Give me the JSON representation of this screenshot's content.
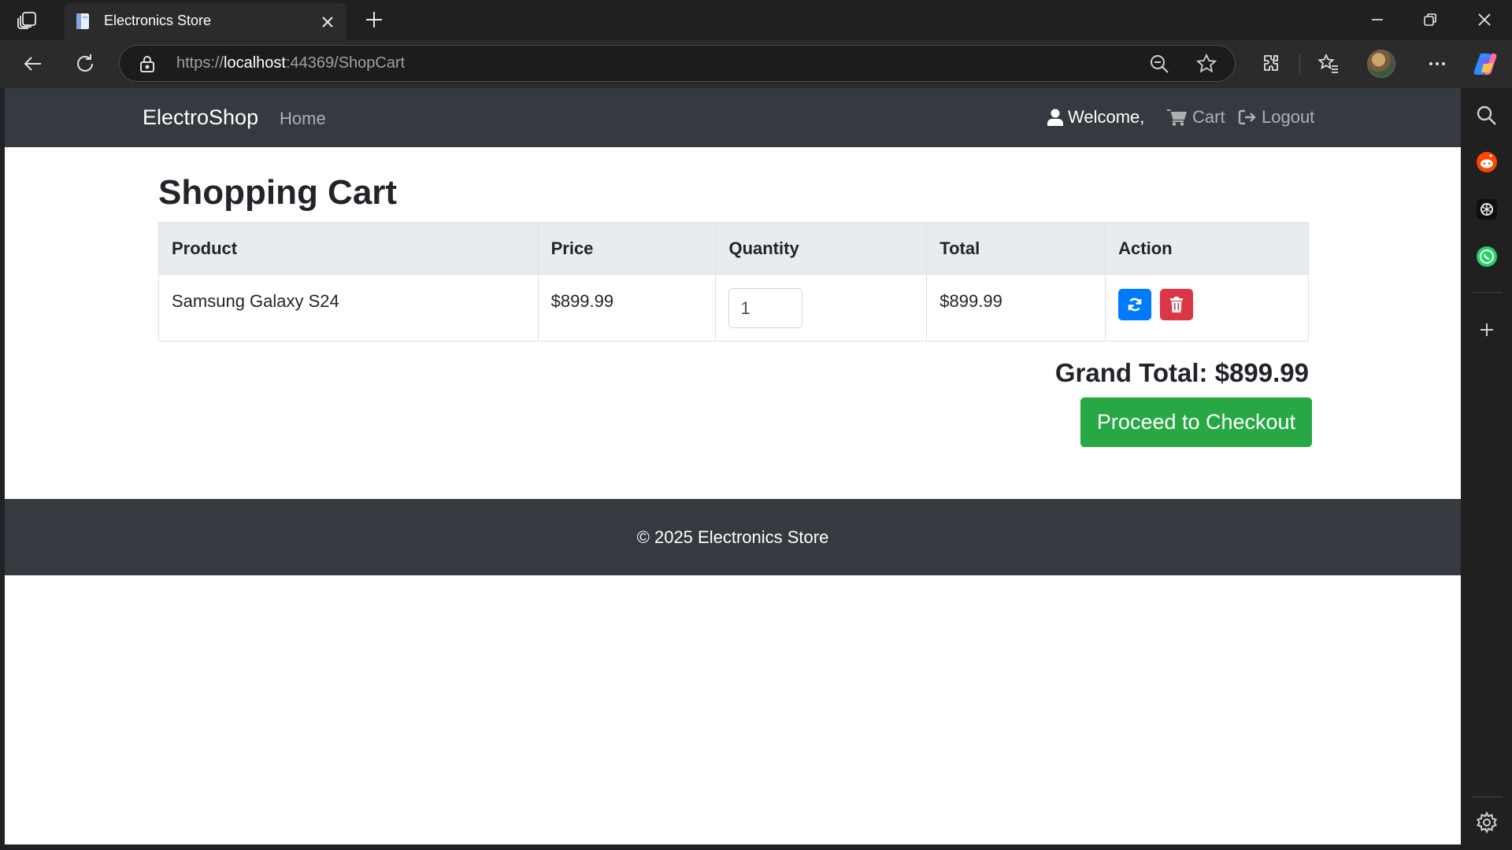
{
  "browser": {
    "tab_title": "Electronics Store",
    "url_scheme": "https://",
    "url_host": "localhost",
    "url_rest": ":44369/ShopCart"
  },
  "navbar": {
    "brand": "ElectroShop",
    "home": "Home",
    "welcome": "Welcome,",
    "cart": "Cart",
    "logout": "Logout"
  },
  "page": {
    "title": "Shopping Cart"
  },
  "cart": {
    "headers": [
      "Product",
      "Price",
      "Quantity",
      "Total",
      "Action"
    ],
    "rows": [
      {
        "product": "Samsung Galaxy S24",
        "price": "$899.99",
        "quantity": "1",
        "total": "$899.99"
      }
    ],
    "grand_total": "Grand Total: $899.99",
    "checkout_label": "Proceed to Checkout"
  },
  "footer": {
    "text": "© 2025 Electronics Store"
  },
  "colors": {
    "navbar_bg": "#343a40",
    "primary": "#007bff",
    "danger": "#dc3545",
    "success": "#28a745"
  },
  "icons": {
    "welcome": "user-icon",
    "cart": "shopping-cart-icon",
    "logout": "sign-out-icon",
    "update": "refresh-icon",
    "remove": "trash-icon"
  }
}
